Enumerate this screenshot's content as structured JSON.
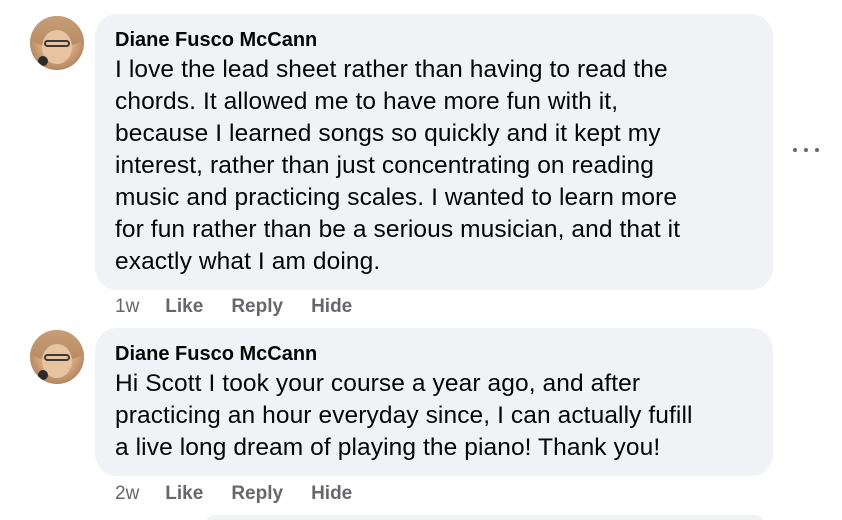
{
  "comments": [
    {
      "author": "Diane Fusco McCann",
      "text": "I love the lead sheet rather than having to read the chords. It allowed me to have more fun with it, because I learned songs so quickly and it kept my interest, rather than just concentrating on reading music and practicing scales. I wanted to learn more for fun rather than be a serious musician, and that it exactly what I am doing.",
      "lines": [
        "I love the lead sheet rather than having to read the",
        "chords. It allowed me to have more fun with it,",
        "because I learned songs so quickly and it kept my",
        "interest, rather than just concentrating on reading",
        "music and practicing scales. I wanted to learn more",
        "for fun rather than be a serious musician, and that it",
        "exactly what I am doing."
      ],
      "time": "1w",
      "like_label": "Like",
      "reply_label": "Reply",
      "hide_label": "Hide"
    },
    {
      "author": "Diane Fusco McCann",
      "text": "Hi Scott I took your course a year ago, and after practicing an hour everyday since, I can actually fufill a live long dream of playing the piano! Thank you!",
      "lines": [
        "Hi Scott I took your course a year ago, and after",
        "practicing an hour everyday since, I can actually fufill",
        "a live long dream of playing the piano! Thank you!"
      ],
      "time": "2w",
      "like_label": "Like",
      "reply_label": "Reply",
      "hide_label": "Hide"
    }
  ],
  "more_options_icon": "more-horizontal-icon",
  "colors": {
    "bubble": "#f0f2f5",
    "text": "#050505",
    "secondary": "#65676b"
  }
}
